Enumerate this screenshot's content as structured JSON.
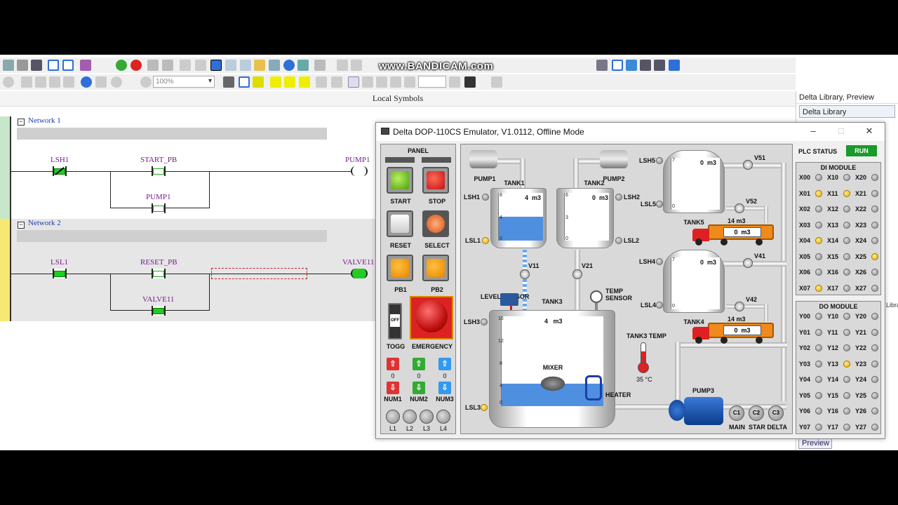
{
  "watermark": "www.BANDICAM.com",
  "toolbar": {
    "zoom_value": "100%"
  },
  "local_symbols_label": "Local Symbols",
  "library": {
    "title": "Delta Library, Preview",
    "item": "Delta Library",
    "preview_tab": "Preview",
    "partial_tab": "Libra"
  },
  "ladder": {
    "network1": {
      "label": "Network 1",
      "contacts": [
        "LSH1",
        "START_PB",
        "PUMP1"
      ],
      "coil": "PUMP1"
    },
    "network2": {
      "label": "Network 2",
      "contacts": [
        "LSL1",
        "RESET_PB",
        "VALVE11"
      ],
      "coil": "VALVE11"
    }
  },
  "emulator": {
    "title": "Delta DOP-110CS Emulator, V1.0112, Offline Mode",
    "panel": {
      "title": "PANEL",
      "buttons": [
        "START",
        "STOP",
        "RESET",
        "SELECT",
        "PB1",
        "PB2",
        "TOGG",
        "EMERGENCY"
      ],
      "toggle_state": "OFF",
      "num_values": [
        "0",
        "0",
        "0"
      ],
      "num_labels": [
        "NUM1",
        "NUM2",
        "NUM3"
      ],
      "lamps": [
        "L1",
        "L2",
        "L3",
        "L4"
      ]
    },
    "process": {
      "pump1": "PUMP1",
      "pump2": "PUMP2",
      "pump3": "PUMP3",
      "tank1": {
        "label": "TANK1",
        "value": "4",
        "unit": "m3",
        "scale": [
          "8",
          "4",
          "0"
        ],
        "level": 0.5
      },
      "tank2": {
        "label": "TANK2",
        "value": "0",
        "unit": "m3",
        "scale": [
          "6",
          "3",
          "0"
        ],
        "level": 0
      },
      "tank3": {
        "label": "TANK3",
        "value": "4",
        "unit": "m3",
        "scale": [
          "16",
          "12",
          "8",
          "4",
          "0"
        ],
        "level": 0.25
      },
      "tank4": {
        "label": "TANK4",
        "value": "0",
        "unit": "m3",
        "scale": [
          "7",
          "0"
        ],
        "level": 0
      },
      "tank5": {
        "label": "TANK5",
        "value": "0",
        "unit": "m3",
        "scale": [
          "7",
          "0"
        ],
        "level": 0
      },
      "sensors": [
        "LSH1",
        "LSL1",
        "LSH2",
        "LSL2",
        "LSH3",
        "LSL3",
        "LSH4",
        "LSL4",
        "LSH5",
        "LSL5"
      ],
      "valves": [
        "V11",
        "V21",
        "V41",
        "V42",
        "V51",
        "V52"
      ],
      "level_sensor": "LEVEL SENSOR",
      "temp_sensor": "TEMP SENSOR",
      "tank3_temp_label": "TANK3 TEMP",
      "tank3_temp_value": "35 °C",
      "mixer": "MIXER",
      "heater": "HEATER",
      "truck1": {
        "top": "14 m3",
        "value": "0",
        "unit": "m3"
      },
      "truck2": {
        "top": "14 m3",
        "value": "0",
        "unit": "m3"
      },
      "motor_buttons": [
        "C1",
        "C2",
        "C3"
      ],
      "motor_labels": [
        "MAIN",
        "STAR DELTA"
      ]
    },
    "plc": {
      "status_label": "PLC STATUS",
      "status": "RUN",
      "di_title": "DI MODULE",
      "do_title": "DO MODULE",
      "di_cols": [
        [
          "X00",
          "X01",
          "X02",
          "X03",
          "X04",
          "X05",
          "X06",
          "X07"
        ],
        [
          "X10",
          "X11",
          "X12",
          "X13",
          "X14",
          "X15",
          "X16",
          "X17"
        ],
        [
          "X20",
          "X21",
          "X22",
          "X23",
          "X24",
          "X25",
          "X26",
          "X27"
        ]
      ],
      "di_on": [
        "X01",
        "X04",
        "X07",
        "X11",
        "X25"
      ],
      "do_cols": [
        [
          "Y00",
          "Y01",
          "Y02",
          "Y03",
          "Y04",
          "Y05",
          "Y06",
          "Y07"
        ],
        [
          "Y10",
          "Y11",
          "Y12",
          "Y13",
          "Y14",
          "Y15",
          "Y16",
          "Y17"
        ],
        [
          "Y20",
          "Y21",
          "Y22",
          "Y23",
          "Y24",
          "Y25",
          "Y26",
          "Y27"
        ]
      ],
      "do_on": [
        "Y13"
      ]
    }
  }
}
